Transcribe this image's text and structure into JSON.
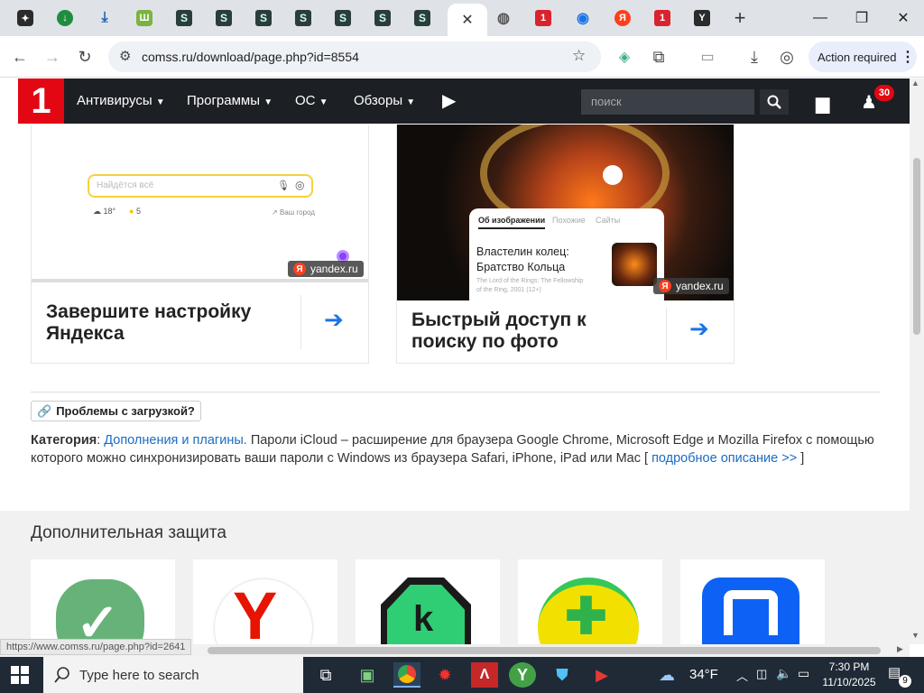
{
  "browser": {
    "tabs": [
      {
        "icon": "site-icon",
        "active": false
      },
      {
        "icon": "download-circle-icon",
        "active": false
      },
      {
        "icon": "download-arrow-icon",
        "active": false
      },
      {
        "icon": "spreadsheet-icon",
        "active": false
      },
      {
        "icon": "s-icon",
        "active": false
      },
      {
        "icon": "s-icon",
        "active": false
      },
      {
        "icon": "s-icon",
        "active": false
      },
      {
        "icon": "s-icon",
        "active": false
      },
      {
        "icon": "s-icon",
        "active": false
      },
      {
        "icon": "s-icon",
        "active": false
      },
      {
        "icon": "s-icon",
        "active": false
      },
      {
        "icon": "close-icon",
        "active": true
      },
      {
        "icon": "globe-icon",
        "active": false
      },
      {
        "icon": "comss-icon",
        "active": false
      },
      {
        "icon": "chrome-icon",
        "active": false
      },
      {
        "icon": "yandex-icon",
        "active": false
      },
      {
        "icon": "comss-icon",
        "active": false
      },
      {
        "icon": "yandex-browser-icon",
        "active": false
      }
    ],
    "url": "comss.ru/download/page.php?id=8554",
    "action_required": "Action required"
  },
  "site": {
    "logo": "1",
    "nav": [
      "Антивирусы",
      "Программы",
      "ОС",
      "Обзоры"
    ],
    "search_placeholder": "поиск",
    "notif_count": "30"
  },
  "cards": [
    {
      "title": "Завершите настройку Яндекса",
      "search_placeholder": "Найдётся всё",
      "weather": "18°",
      "score": "5",
      "city": "Ваш город",
      "tag": "yandex.ru"
    },
    {
      "title": "Быстрый доступ к поиску по фото",
      "tabs": [
        "Об изображении",
        "Похожие",
        "Сайты"
      ],
      "result_title": "Властелин колец: Братство Кольца",
      "result_sub": "The Lord of the Rings: The Fellowship of the Ring, 2001 (12+)",
      "tag": "yandex.ru"
    }
  ],
  "problems_button": "Проблемы с загрузкой?",
  "category": {
    "label": "Категория",
    "link": "Дополнения и плагины.",
    "text": " Пароли iCloud – расширение для браузера Google Chrome, Microsoft Edge и Mozilla Firefox с помощью которого можно синхронизировать ваши пароли с Windows из браузера Safari, iPhone, iPad или Mac [ ",
    "more": "подробное описание >>",
    "end": " ]"
  },
  "extra": {
    "title": "Дополнительная защита",
    "apps": [
      "adguard-icon",
      "yandex-browser-icon",
      "kaspersky-icon",
      "360-total-security-icon",
      "malwarebytes-icon"
    ]
  },
  "status_url": "https://www.comss.ru/page.php?id=2641",
  "taskbar": {
    "search": "Type here to search",
    "weather": "34°F",
    "time": "7:30 PM",
    "date": "11/10/2025",
    "notifications": "9"
  },
  "colors": {
    "accent": "#e30613",
    "link": "#1a6cc4",
    "header": "#1c1f24"
  }
}
